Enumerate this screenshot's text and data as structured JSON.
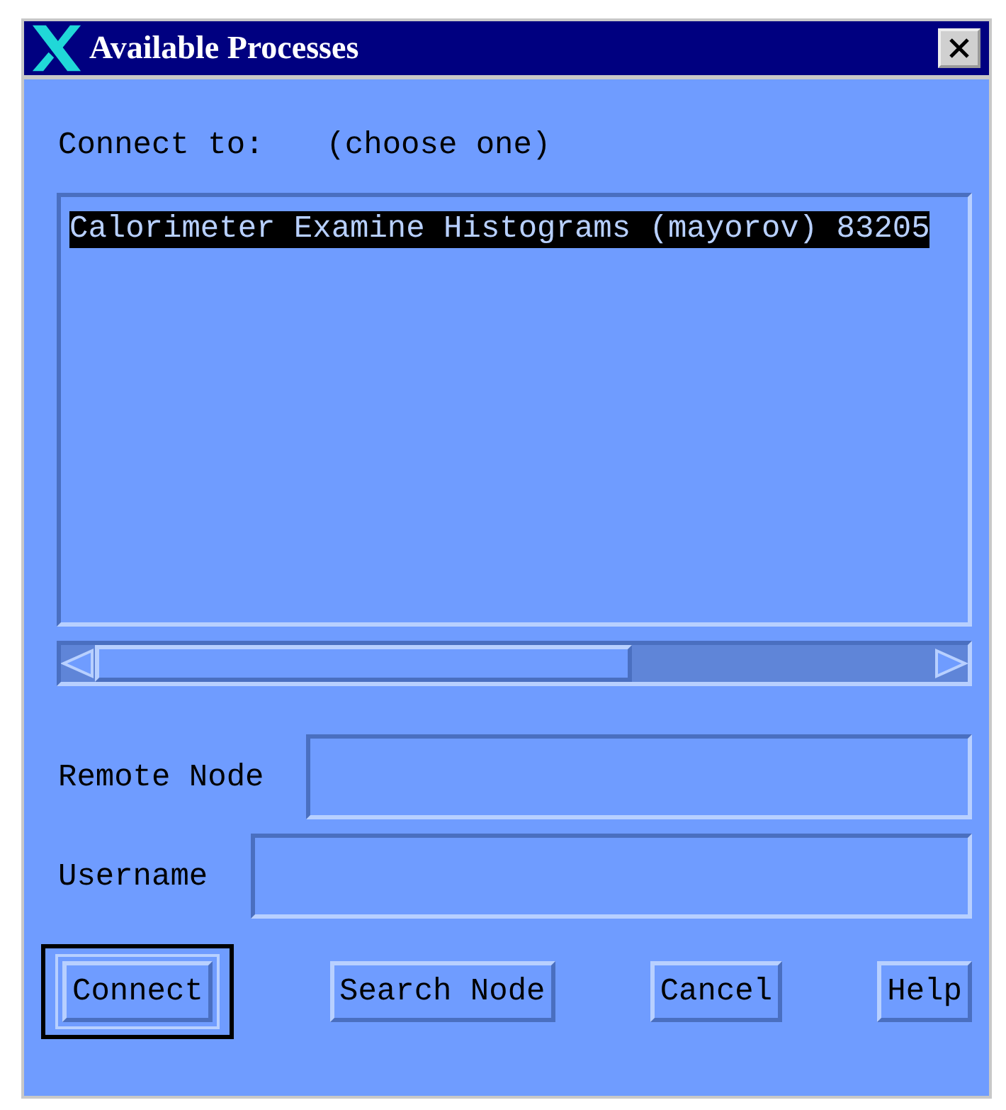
{
  "window": {
    "title": "Available Processes"
  },
  "connect_label": "Connect to:",
  "connect_hint": "(choose one)",
  "processes": [
    {
      "text": "Calorimeter Examine Histograms (mayorov) 83205",
      "selected": true
    }
  ],
  "fields": [
    {
      "label": "Remote Node"
    },
    {
      "label": "Username"
    }
  ],
  "buttons": [
    {
      "label": "Connect",
      "default": true
    },
    {
      "label": "Search Node",
      "default": false
    },
    {
      "label": "Cancel",
      "default": false
    },
    {
      "label": "Help",
      "default": false
    }
  ]
}
